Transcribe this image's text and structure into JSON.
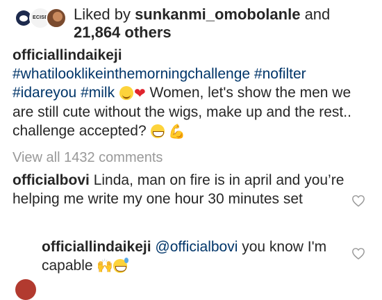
{
  "likes": {
    "prefix": "Liked by ",
    "user": "sunkanmi_omobolanle",
    "middle": " and ",
    "count": "21,864",
    "suffix": " others",
    "avatar2_text": "ECISE"
  },
  "caption": {
    "username": "officiallindaikeji",
    "hashtag1": "#whatilooklikeinthemorningchallenge",
    "hashtag2": "#nofilter",
    "hashtag3": "#idareyou",
    "hashtag4": "#milk",
    "text": " Women, let's show the men we are still cute without the wigs, make up and the rest.. challenge accepted? "
  },
  "view_all_comments": "View all 1432 comments",
  "comments": [
    {
      "username": "officialbovi",
      "text": " Linda, man on fire is in april and you’re helping me write my one hour 30 minutes set"
    }
  ],
  "reply": {
    "username": "officiallindaikeji",
    "mention": "@officialbovi",
    "text": " you know I'm capable "
  },
  "icons": {
    "like": "heart-outline-icon",
    "emojis": [
      "yum-face-emoji",
      "red-heart-emoji",
      "grin-emoji",
      "flexed-biceps-emoji",
      "raised-hands-emoji",
      "sweat-smile-emoji"
    ]
  },
  "colors": {
    "text": "#262626",
    "link": "#003569",
    "muted": "#999999"
  }
}
